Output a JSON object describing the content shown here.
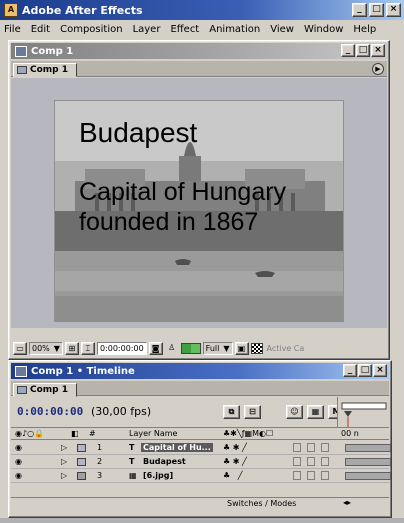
{
  "app": {
    "title": "Adobe After Effects"
  },
  "menu": [
    "File",
    "Edit",
    "Composition",
    "Layer",
    "Effect",
    "Animation",
    "View",
    "Window",
    "Help"
  ],
  "comp_window": {
    "title": "Comp 1",
    "tab": "Comp 1",
    "slide": {
      "title": "Budapest",
      "subtitle": "Capital of Hungary founded in 1867"
    },
    "viewer_bar": {
      "zoom": "00%",
      "timecode": "0:00:00:00",
      "resolution": "Full",
      "camera": "Active Ca"
    }
  },
  "timeline": {
    "title": "Comp 1 • Timeline",
    "tab": "Comp 1",
    "current_time": "0:00:00:00",
    "fps": "(30,00 fps)",
    "columns": {
      "number": "#",
      "layer_name": "Layer Name",
      "time": "00 n"
    },
    "layers": [
      {
        "number": "1",
        "type_icon": "T",
        "name": "Capital of Hu...",
        "color": "#b4b4c8",
        "selected": true
      },
      {
        "number": "2",
        "type_icon": "T",
        "name": "Budapest",
        "color": "#b4b4c8",
        "selected": false
      },
      {
        "number": "3",
        "type_icon": "▦",
        "name": "[6.jpg]",
        "color": "#a0a0a0",
        "selected": false
      }
    ],
    "footer_label": "Switches / Modes"
  },
  "colors": {
    "title_active": "#1c3c8c",
    "title_inactive": "#808080",
    "chrome": "#d4d0c8",
    "viewer_bg": "#b7b8bf"
  }
}
